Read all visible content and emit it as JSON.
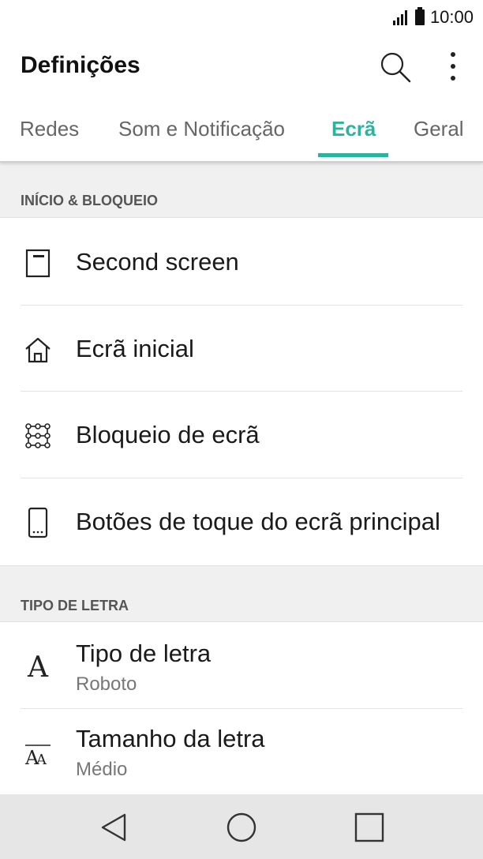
{
  "status_bar": {
    "time": "10:00"
  },
  "app_bar": {
    "title": "Definições"
  },
  "tabs": [
    {
      "label": "Redes",
      "active": false
    },
    {
      "label": "Som e Notificação",
      "active": false
    },
    {
      "label": "Ecrã",
      "active": true
    },
    {
      "label": "Geral",
      "active": false
    }
  ],
  "sections": [
    {
      "header": "INÍCIO & BLOQUEIO",
      "items": [
        {
          "label": "Second screen",
          "icon": "second-screen-icon"
        },
        {
          "label": "Ecrã inicial",
          "icon": "home-icon"
        },
        {
          "label": "Bloqueio de ecrã",
          "icon": "lock-pattern-icon"
        },
        {
          "label": "Botões de toque do ecrã principal",
          "icon": "home-touch-buttons-icon"
        }
      ]
    },
    {
      "header": "TIPO DE LETRA",
      "items": [
        {
          "label": "Tipo de letra",
          "sub": "Roboto",
          "icon": "font-type-icon"
        },
        {
          "label": "Tamanho da letra",
          "sub": "Médio",
          "icon": "font-size-icon"
        }
      ]
    }
  ],
  "colors": {
    "accent": "#2bb3a0",
    "section_bg": "#f0f0f0",
    "nav_bg": "#e6e6e6"
  }
}
